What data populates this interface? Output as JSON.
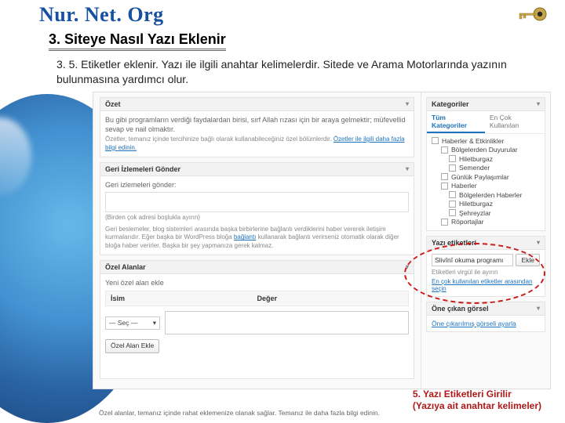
{
  "site": {
    "title": "Nur. Net. Org"
  },
  "section": {
    "title": "3. Siteye Nasıl Yazı Eklenir",
    "desc": "3. 5. Etiketler eklenir. Yazı ile ilgili anahtar kelimelerdir. Sitede ve Arama Motorlarında yazının bulunmasına yardımcı olur."
  },
  "left": {
    "summary": {
      "header": "Özet",
      "body": "Bu gibi programların verdiği faydalardan birisi, sırf Allah rızası için bir araya gelmektir; müfevellid sevap ve nail olmaktır.",
      "note_prefix": "Özetler, temanız içinde tercihinize bağlı olarak kullanabileceğiniz özel bölümlerdir. ",
      "note_link": "Özetler ile ilgili daha fazla bilgi edinin."
    },
    "trackback": {
      "header": "Geri İzlemeleri Gönder",
      "label": "Geri izlemeleri gönder:",
      "hint": "(Birden çok adresi boşlukla ayırın)",
      "desc_prefix": "Geri beslemeler, blog sistemleri arasında başka birbirlerine bağlantı verdiklerini haber vererek iletişim kurmalarıdır. Eğer başka bir WordPress bloğa ",
      "desc_link": "bağlantı",
      "desc_suffix": " kullanarak bağlantı verirseniz otomatik olarak diğer bloğa haber verirler. Başka bir şey yapmanıza gerek kalmaz."
    },
    "custom": {
      "header": "Özel Alanlar",
      "add": "Yeni özel alan ekle",
      "th_name": "İsim",
      "th_value": "Değer",
      "select_placeholder": "— Seç —",
      "btn": "Özel Alan Ekle"
    },
    "footer_note": "Özel alanlar, temanız içinde rahat eklemenize olanak sağlar. Temanız ile daha fazla bilgi edinin."
  },
  "right": {
    "categories": {
      "header": "Kategoriler",
      "tab_all": "Tüm Kategoriler",
      "tab_most": "En Çok Kullanılan",
      "items": [
        {
          "label": "Haberler & Etkinlikler",
          "indent": 0
        },
        {
          "label": "Bölgelerden Duyurular",
          "indent": 1
        },
        {
          "label": "Hiletburgaz",
          "indent": 2
        },
        {
          "label": "Semender",
          "indent": 2
        },
        {
          "label": "Günlük Paylaşımlar",
          "indent": 1
        },
        {
          "label": "Haberler",
          "indent": 1
        },
        {
          "label": "Bölgelerden Haberler",
          "indent": 2
        },
        {
          "label": "Hiletburgaz",
          "indent": 2
        },
        {
          "label": "Şehreyzlar",
          "indent": 2
        },
        {
          "label": "Röportajlar",
          "indent": 1
        }
      ]
    },
    "tags": {
      "header": "Yazı etiketleri",
      "input_value": "Slivînî okuma programı",
      "add_btn": "Ekle",
      "hint": "Etiketleri virgül ile ayırın",
      "link": "En çok kullanılan etiketler arasından seçin"
    },
    "featured": {
      "header": "Öne çıkan görsel",
      "link": "Öne çıkarılmış görseli ayarla"
    }
  },
  "callout": {
    "line1": "5. Yazı Etiketleri Girilir",
    "line2": "(Yazıya ait anahtar kelimeler)"
  }
}
